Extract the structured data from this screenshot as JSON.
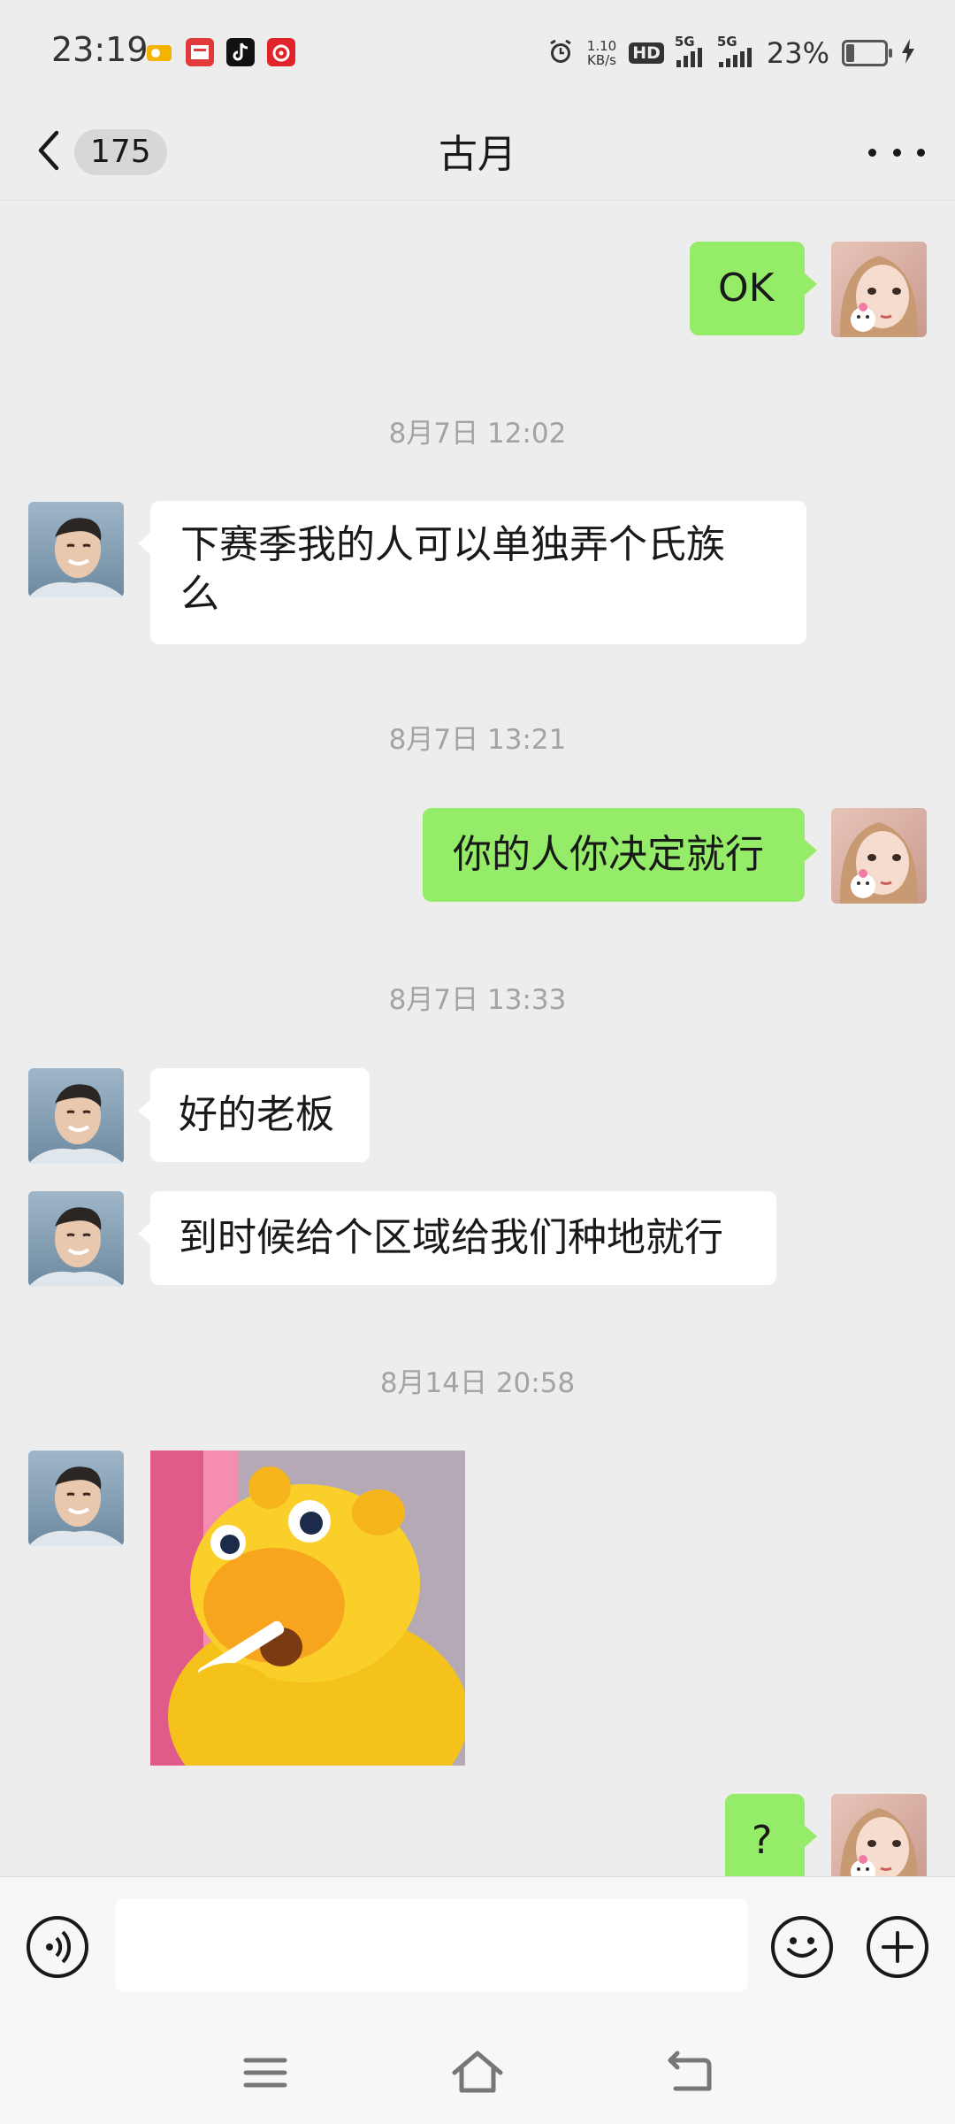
{
  "status_bar": {
    "time": "23:19",
    "net_speed_value": "1.10",
    "net_speed_unit": "KB/s",
    "hd_label": "HD",
    "signal1_label": "5G",
    "signal2_label": "5G",
    "battery_percent": "23%",
    "battery_level": 0.23,
    "app_icons": [
      "bank-app-icon",
      "cmb-app-icon",
      "tiktok-icon",
      "netease-music-icon"
    ]
  },
  "nav": {
    "unread_count": "175",
    "title": "古月"
  },
  "messages": [
    {
      "type": "out_text",
      "text": "OK"
    },
    {
      "type": "timestamp",
      "text": "8月7日 12:02"
    },
    {
      "type": "in_text",
      "text_line1": "下赛季我的人可以单独弄个氏族",
      "text_line2": "么"
    },
    {
      "type": "timestamp",
      "text": "8月7日 13:21"
    },
    {
      "type": "out_text",
      "text": "你的人你决定就行"
    },
    {
      "type": "timestamp",
      "text": "8月7日 13:33"
    },
    {
      "type": "in_text",
      "text": "好的老板"
    },
    {
      "type": "in_text",
      "text": "到时候给个区域给我们种地就行"
    },
    {
      "type": "timestamp",
      "text": "8月14日 20:58"
    },
    {
      "type": "in_sticker",
      "sticker": "yellow-cartoon-bear-smoking-sticker"
    },
    {
      "type": "out_text",
      "text": "?"
    }
  ],
  "colors": {
    "background": "#ededed",
    "incoming_bubble": "#ffffff",
    "outgoing_bubble": "#95ec69",
    "timestamp_text": "#a3a3a3"
  },
  "input_bar": {
    "voice_icon": "voice-icon",
    "emoji_icon": "emoji-icon",
    "plus_icon": "plus-icon",
    "text_value": ""
  },
  "system_nav": {
    "icons": [
      "menu-icon",
      "home-icon",
      "back-icon"
    ]
  }
}
